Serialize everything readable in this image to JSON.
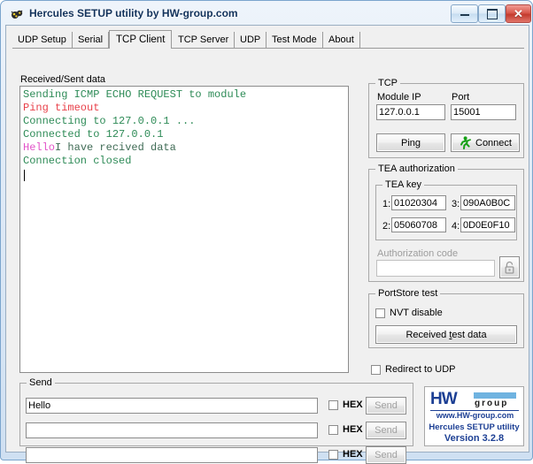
{
  "window": {
    "title": "Hercules SETUP utility by HW-group.com",
    "icon": "hercules-app-icon",
    "controls": {
      "minimize": "minimize-button",
      "maximize": "maximize-button",
      "close": "✕"
    }
  },
  "tabs": [
    {
      "label": "UDP Setup",
      "active": false
    },
    {
      "label": "Serial",
      "active": false
    },
    {
      "label": "TCP Client",
      "active": true
    },
    {
      "label": "TCP Server",
      "active": false
    },
    {
      "label": "UDP",
      "active": false
    },
    {
      "label": "Test Mode",
      "active": false
    },
    {
      "label": "About",
      "active": false
    }
  ],
  "log": {
    "label": "Received/Sent data",
    "lines": [
      {
        "segments": [
          {
            "text": "Sending ICMP ECHO REQUEST to module",
            "color": "#2e8b57"
          }
        ]
      },
      {
        "segments": [
          {
            "text": "Ping timeout",
            "color": "#e8414a"
          }
        ]
      },
      {
        "segments": [
          {
            "text": "Connecting to 127.0.0.1 ...",
            "color": "#2e8b57"
          }
        ]
      },
      {
        "segments": [
          {
            "text": "Connected to 127.0.0.1",
            "color": "#2e8b57"
          }
        ]
      },
      {
        "segments": [
          {
            "text": "Hello",
            "color": "#e255c9"
          },
          {
            "text": "I have recived data",
            "color": "#3f6b55"
          }
        ]
      },
      {
        "segments": [
          {
            "text": "Connection closed",
            "color": "#2e8b57"
          }
        ]
      }
    ]
  },
  "tcp": {
    "legend": "TCP",
    "module_ip_label": "Module IP",
    "module_ip_value": "127.0.0.1",
    "port_label": "Port",
    "port_value": "15001",
    "ping_button": "Ping",
    "connect_button": "Connect",
    "connect_icon": "running-man-icon"
  },
  "tea": {
    "legend": "TEA authorization",
    "key_legend": "TEA key",
    "keys": [
      {
        "index": "1:",
        "value": "01020304"
      },
      {
        "index": "2:",
        "value": "05060708"
      },
      {
        "index": "3:",
        "value": "090A0B0C"
      },
      {
        "index": "4:",
        "value": "0D0E0F10"
      }
    ],
    "auth_code_label": "Authorization code",
    "auth_code_value": "",
    "lock_icon": "padlock-icon"
  },
  "portstore": {
    "legend": "PortStore test",
    "nvt_disable_label": "NVT disable",
    "nvt_disable_checked": false,
    "received_test_data_button": "Received test data",
    "received_test_data_accel": "t"
  },
  "redirect": {
    "label": "Redirect to UDP",
    "checked": false
  },
  "send": {
    "legend": "Send",
    "rows": [
      {
        "value": "Hello",
        "hex_label": "HEX",
        "hex_checked": false,
        "send_label": "Send",
        "send_enabled": false
      },
      {
        "value": "",
        "hex_label": "HEX",
        "hex_checked": false,
        "send_label": "Send",
        "send_enabled": false
      },
      {
        "value": "",
        "hex_label": "HEX",
        "hex_checked": false,
        "send_label": "Send",
        "send_enabled": false
      }
    ]
  },
  "logo": {
    "hw": "HW",
    "group": "group",
    "url": "www.HW-group.com",
    "product": "Hercules SETUP utility",
    "version": "Version  3.2.8"
  },
  "colors": {
    "accent_blue": "#1c3f94",
    "logo_bar": "#6fb3e0",
    "log_green": "#2e8b57",
    "log_red": "#e8414a",
    "log_magenta": "#e255c9",
    "titlebar_text": "#12325b"
  }
}
